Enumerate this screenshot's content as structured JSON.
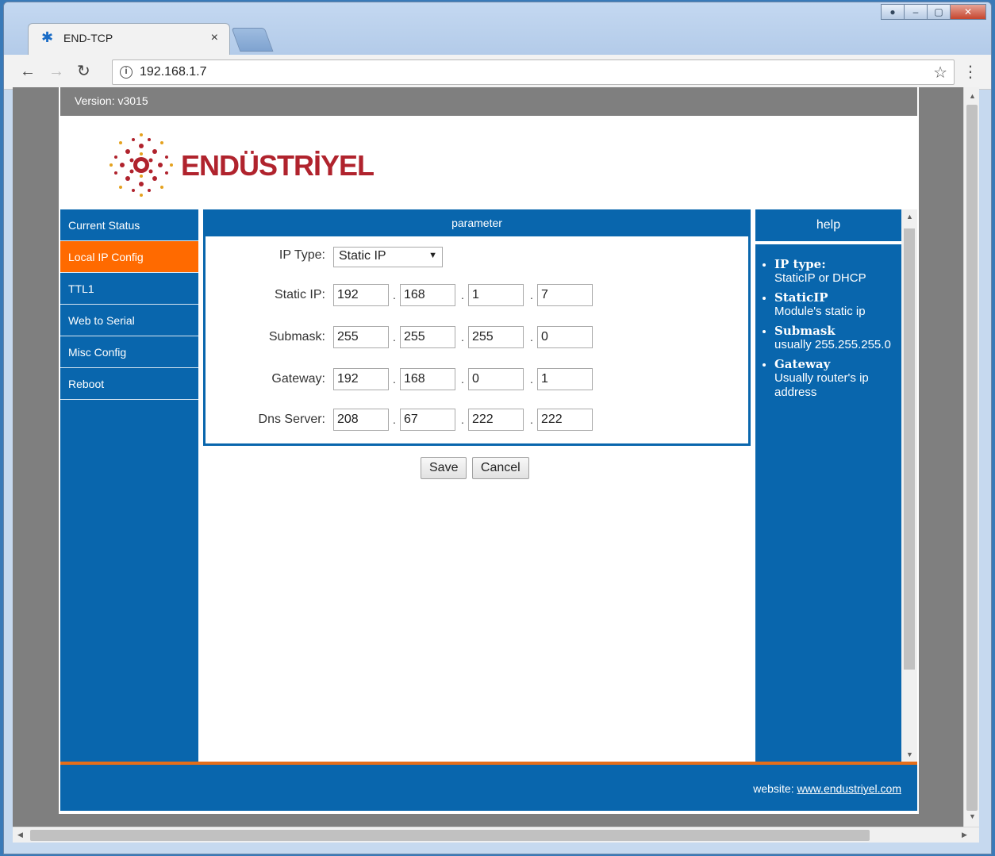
{
  "browser": {
    "tab_title": "END-TCP",
    "tab_close": "×",
    "url": "192.168.1.7"
  },
  "page": {
    "version_label": "Version: v3015",
    "logo_text": "ENDÜSTRİYEL"
  },
  "sidebar": {
    "items": [
      {
        "label": "Current Status"
      },
      {
        "label": "Local IP Config",
        "active": true
      },
      {
        "label": "TTL1"
      },
      {
        "label": "Web to Serial"
      },
      {
        "label": "Misc Config"
      },
      {
        "label": "Reboot"
      }
    ]
  },
  "parameter": {
    "title": "parameter",
    "ip_type": {
      "label": "IP Type:",
      "value": "Static IP"
    },
    "static_ip": {
      "label": "Static IP:",
      "octets": [
        "192",
        "168",
        "1",
        "7"
      ]
    },
    "submask": {
      "label": "Submask:",
      "octets": [
        "255",
        "255",
        "255",
        "0"
      ]
    },
    "gateway": {
      "label": "Gateway:",
      "octets": [
        "192",
        "168",
        "0",
        "1"
      ]
    },
    "dns": {
      "label": "Dns Server:",
      "octets": [
        "208",
        "67",
        "222",
        "222"
      ]
    }
  },
  "buttons": {
    "save": "Save",
    "cancel": "Cancel"
  },
  "help": {
    "title": "help",
    "items": [
      {
        "title": "IP type:",
        "text": "StaticIP or DHCP"
      },
      {
        "title": "StaticIP",
        "text": "Module's static ip"
      },
      {
        "title": "Submask",
        "text": "usually 255.255.255.0"
      },
      {
        "title": "Gateway",
        "text": "Usually router's ip address"
      }
    ]
  },
  "footer": {
    "label": "website:",
    "link": "www.endustriyel.com"
  },
  "colors": {
    "primary": "#0966ad",
    "accent": "#ff6a00",
    "brand": "#b0232d"
  }
}
